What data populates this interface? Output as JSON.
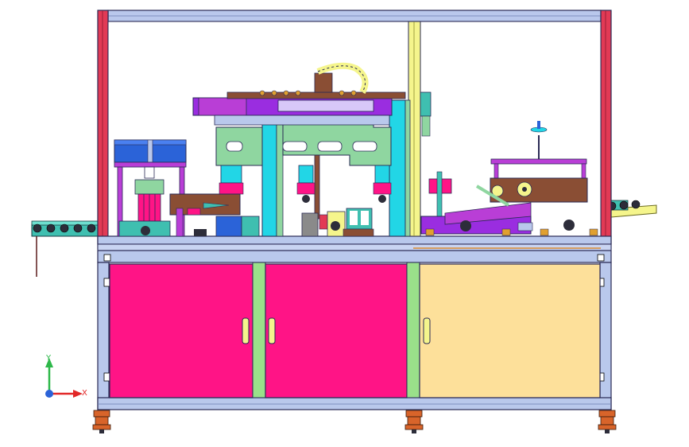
{
  "view": {
    "triad": {
      "x_label": "X",
      "y_label": "Y"
    }
  },
  "colors": {
    "frame_blue": "#b9c8ec",
    "frame_outline": "#2a2a55",
    "post_red": "#e23a55",
    "door_magenta": "#ff1486",
    "door_cream": "#fde09a",
    "door_divider_green": "#9ae08a",
    "base_teal": "#3fbfb0",
    "mount_purple": "#b93ed6",
    "plate_green": "#8fd6a0",
    "rail_cyan": "#22d6e6",
    "cylinder_blue": "#2b63d8",
    "wood_brown": "#8a4e34",
    "conveyor_yellow": "#f5f58c",
    "violet_plate": "#9a2de0",
    "caster_orange": "#d8642a"
  },
  "components": [
    "machine-frame",
    "enclosure-posts",
    "upper-work-chamber",
    "cabinet-doors",
    "door-handles",
    "left-conveyor",
    "right-conveyor",
    "gantry-beam",
    "cable-chain",
    "gantry-bracket",
    "vertical-rails",
    "feed-bowl-station",
    "press-station",
    "labeling-station",
    "leveling-casters",
    "coordinate-triad"
  ]
}
